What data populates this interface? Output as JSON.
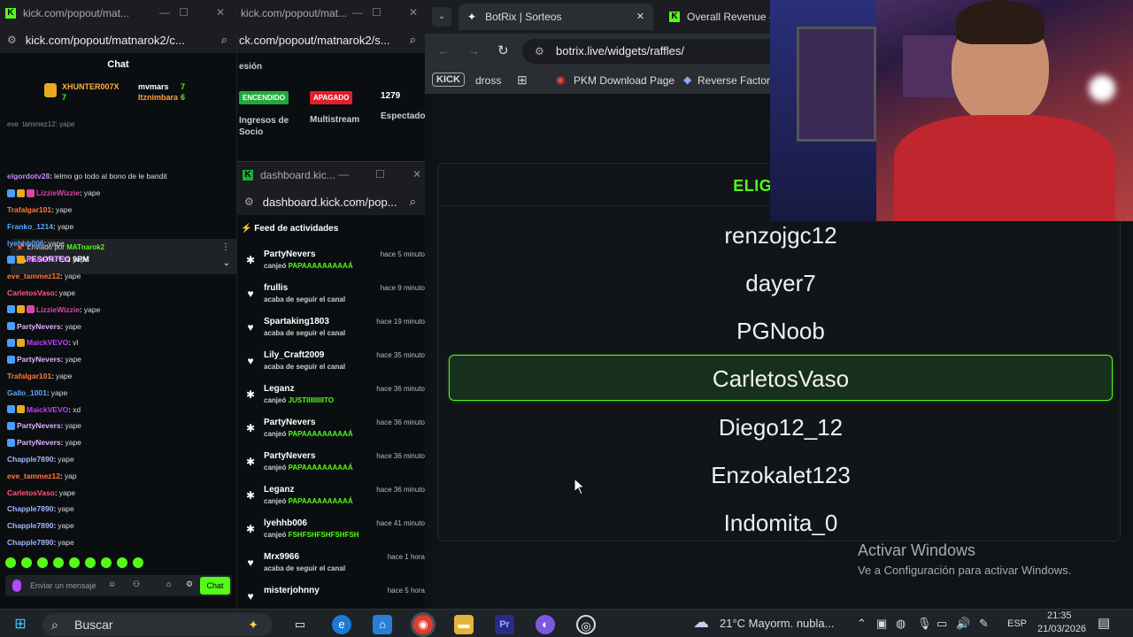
{
  "chat_window": {
    "title": "kick.com/popout/mat...",
    "address": "kick.com/popout/matnarok2/c...",
    "header": "Chat",
    "gifters": [
      {
        "name": "XHUNTER007X",
        "count": "7"
      },
      {
        "name": "mvmars",
        "count": "7"
      },
      {
        "name": "Itznimbara",
        "count": "6"
      }
    ],
    "partial_top": "eve_tammez12: yape",
    "pinned": {
      "sender_prefix": "Enviado por",
      "sender": "MATnarok2",
      "title": "YAPESORTEO 9PM"
    },
    "messages": [
      {
        "user": "elgordotv28",
        "text": "lelmo go todo al bono de le bandit",
        "color": "#c58af9",
        "badges": 0
      },
      {
        "user": "LizzieWizzie",
        "text": "yape",
        "color": "#d946a8",
        "badges": 3
      },
      {
        "user": "Trafalgar101",
        "text": "yape",
        "color": "#ff7a3d",
        "badges": 0
      },
      {
        "user": "Franko_1214",
        "text": "yape",
        "color": "#5aa7ff",
        "badges": 0
      },
      {
        "user": "lyehhb006",
        "text": "yape",
        "color": "#5aa7ff",
        "badges": 0
      },
      {
        "user": "MaickVEVO",
        "text": "yape",
        "color": "#c040ff",
        "badges": 2
      },
      {
        "user": "eve_tammez12",
        "text": "yape",
        "color": "#ff7a3d",
        "badges": 0
      },
      {
        "user": "CarletosVaso",
        "text": "yape",
        "color": "#ff5a7a",
        "badges": 0
      },
      {
        "user": "LizzieWizzie",
        "text": "yape",
        "color": "#d946a8",
        "badges": 3
      },
      {
        "user": "PartyNevers",
        "text": "yape",
        "color": "#e0b0ff",
        "badges": 1
      },
      {
        "user": "MaickVEVO",
        "text": "vl",
        "color": "#c040ff",
        "badges": 2
      },
      {
        "user": "PartyNevers",
        "text": "yape",
        "color": "#e0b0ff",
        "badges": 1
      },
      {
        "user": "Trafalgar101",
        "text": "yape",
        "color": "#ff7a3d",
        "badges": 0
      },
      {
        "user": "Gallo_1001",
        "text": "yape",
        "color": "#5aa7ff",
        "badges": 0
      },
      {
        "user": "MaickVEVO",
        "text": "xd",
        "color": "#c040ff",
        "badges": 2
      },
      {
        "user": "PartyNevers",
        "text": "yape",
        "color": "#e0b0ff",
        "badges": 1
      },
      {
        "user": "PartyNevers",
        "text": "yape",
        "color": "#e0b0ff",
        "badges": 1
      },
      {
        "user": "Chapple7890",
        "text": "yape",
        "color": "#9fb7ff",
        "badges": 0
      },
      {
        "user": "eve_tammez12",
        "text": "yap",
        "color": "#ff7a3d",
        "badges": 0
      },
      {
        "user": "CarletosVaso",
        "text": "yape",
        "color": "#ff5a7a",
        "badges": 0
      },
      {
        "user": "Chapple7890",
        "text": "yape",
        "color": "#9fb7ff",
        "badges": 0
      },
      {
        "user": "Chapple7890",
        "text": "yape",
        "color": "#9fb7ff",
        "badges": 0
      },
      {
        "user": "Chapple7890",
        "text": "yape",
        "color": "#9fb7ff",
        "badges": 0
      }
    ],
    "input_placeholder": "Enviar un mensaje",
    "send_label": "Chat"
  },
  "dashboard_top": {
    "title": "kick.com/popout/mat...",
    "address": "ck.com/popout/matnarok2/s...",
    "partial_heading": "esión",
    "badge_on": "ENCENDIDO",
    "badge_off": "APAGADO",
    "viewers": "1279",
    "label_income": "Ingresos de Socio",
    "label_multistream": "Multistream",
    "label_viewers": "Espectado"
  },
  "dashboard_feed": {
    "title": "dashboard.kic...",
    "address": "dashboard.kick.com/pop...",
    "heading": "Feed de actividades",
    "items": [
      {
        "name": "PartyNevers",
        "action": "canjeó",
        "reward": "PAPAAAAAAAAAÁ",
        "time": "hace 5 minuto",
        "icon": "redeem"
      },
      {
        "name": "frullis",
        "action": "acaba de seguir el canal",
        "reward": "",
        "time": "hace 9 minuto",
        "icon": "heart"
      },
      {
        "name": "Spartaking1803",
        "action": "acaba de seguir el canal",
        "reward": "",
        "time": "hace 19 minuto",
        "icon": "heart"
      },
      {
        "name": "Lily_Craft2009",
        "action": "acaba de seguir el canal",
        "reward": "",
        "time": "hace 35 minuto",
        "icon": "heart"
      },
      {
        "name": "Leganz",
        "action": "canjeó",
        "reward": "JUSTIIIIIIIIITO",
        "time": "hace 36 minuto",
        "icon": "redeem"
      },
      {
        "name": "PartyNevers",
        "action": "canjeó",
        "reward": "PAPAAAAAAAAAÁ",
        "time": "hace 36 minuto",
        "icon": "redeem"
      },
      {
        "name": "PartyNevers",
        "action": "canjeó",
        "reward": "PAPAAAAAAAAAÁ",
        "time": "hace 36 minuto",
        "icon": "redeem"
      },
      {
        "name": "Leganz",
        "action": "canjeó",
        "reward": "PAPAAAAAAAAAÁ",
        "time": "hace 36 minuto",
        "icon": "redeem"
      },
      {
        "name": "lyehhb006",
        "action": "canjeó",
        "reward": "FSHFSHFSHFSHFSH",
        "time": "hace 41 minuto",
        "icon": "redeem"
      },
      {
        "name": "Mrx9966",
        "action": "acaba de seguir el canal",
        "reward": "",
        "time": "hace 1 hora",
        "icon": "heart"
      },
      {
        "name": "misterjohnny",
        "action": "",
        "reward": "",
        "time": "hace 5 hora",
        "icon": "heart"
      }
    ]
  },
  "browser": {
    "tabs": [
      {
        "label": "BotRix | Sorteos",
        "active": true
      },
      {
        "label": "Overall Revenue - K",
        "active": false
      }
    ],
    "url": "botrix.live/widgets/raffles/",
    "bookmarks": [
      "KICK",
      "dross",
      "PKM Download Page",
      "Reverse Factorin"
    ],
    "raffle": {
      "heading": "ELIGIENDO",
      "names": [
        "renzojgc12",
        "dayer7",
        "PGNoob",
        "CarletosVaso",
        "Diego12_12",
        "Enzokalet123",
        "Indomita_0"
      ],
      "selected_index": 3
    }
  },
  "windows_activation": {
    "title": "Activar Windows",
    "subtitle": "Ve a Configuración para activar Windows."
  },
  "taskbar": {
    "search_placeholder": "Buscar",
    "weather": "21°C  Mayorm. nubla...",
    "language": "ESP",
    "time": "21:35",
    "date": "21/03/2026"
  },
  "colors": {
    "kick_green": "#53fc18",
    "on_badge": "#1faa3a",
    "off_badge": "#e0202a"
  }
}
